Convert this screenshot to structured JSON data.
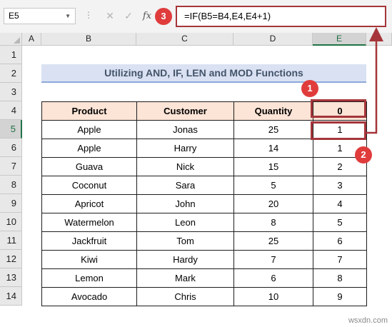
{
  "formula_bar": {
    "name_box": "E5",
    "cancel_symbol": "✕",
    "enter_symbol": "✓",
    "fx_label": "fx",
    "formula": "=IF(B5=B4,E4,E4+1)"
  },
  "columns": [
    "A",
    "B",
    "C",
    "D",
    "E"
  ],
  "rows": [
    "1",
    "2",
    "3",
    "4",
    "5",
    "6",
    "7",
    "8",
    "9",
    "10",
    "11",
    "12",
    "13",
    "14"
  ],
  "selected_cell": "E5",
  "title": "Utilizing AND, IF, LEN and MOD Functions",
  "table": {
    "headers": [
      "Product",
      "Customer",
      "Quantity",
      "0"
    ],
    "rows": [
      [
        "Apple",
        "Jonas",
        "25",
        "1"
      ],
      [
        "Apple",
        "Harry",
        "14",
        "1"
      ],
      [
        "Guava",
        "Nick",
        "15",
        "2"
      ],
      [
        "Coconut",
        "Sara",
        "5",
        "3"
      ],
      [
        "Apricot",
        "John",
        "20",
        "4"
      ],
      [
        "Watermelon",
        "Leon",
        "8",
        "5"
      ],
      [
        "Jackfruit",
        "Tom",
        "25",
        "6"
      ],
      [
        "Kiwi",
        "Hardy",
        "7",
        "7"
      ],
      [
        "Lemon",
        "Mark",
        "6",
        "8"
      ],
      [
        "Avocado",
        "Chris",
        "10",
        "9"
      ]
    ]
  },
  "callouts": [
    "1",
    "2",
    "3"
  ],
  "colors": {
    "accent_red": "#a5353a",
    "badge_red": "#e03c3c",
    "header_fill": "#fce4d6",
    "title_fill": "#d9e1f2",
    "excel_green": "#217346"
  },
  "watermark": "wsxdn.com"
}
